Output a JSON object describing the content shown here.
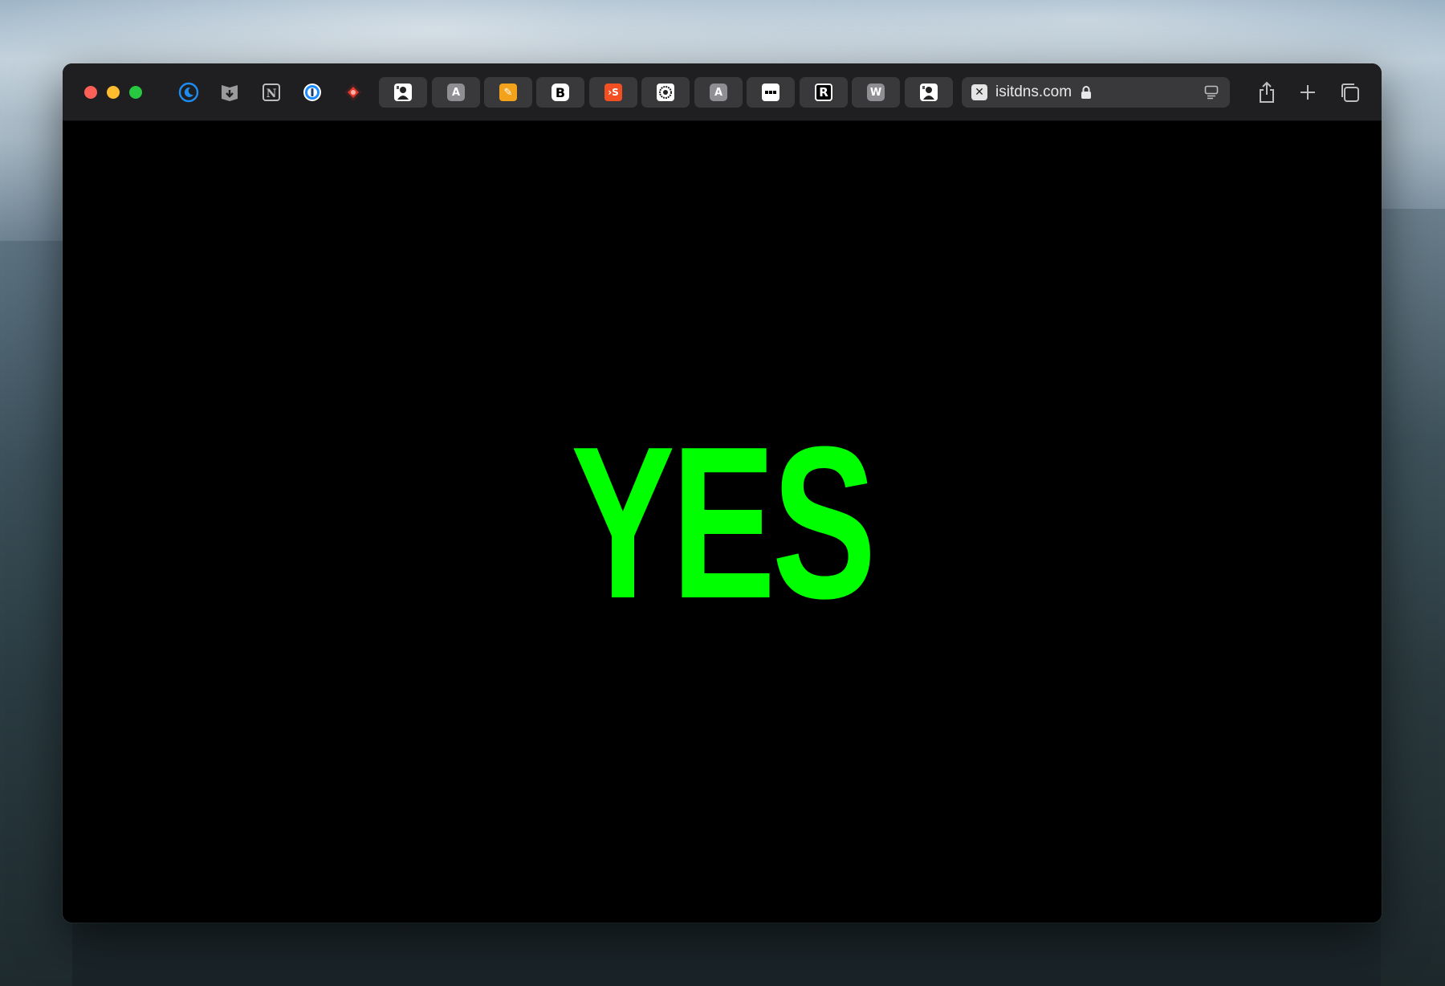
{
  "desktop": {
    "wallpaper": "mountain-landscape"
  },
  "browser": {
    "window_controls": [
      "close",
      "minimize",
      "zoom"
    ],
    "extensions": [
      {
        "name": "moon-icon",
        "color": "#1e8cf0"
      },
      {
        "name": "shield-download-icon",
        "color": "#9a9a9a"
      },
      {
        "name": "notion-icon",
        "glyph": "N"
      },
      {
        "name": "onepassword-icon",
        "color": "#1a8cff"
      },
      {
        "name": "red-diamond-icon",
        "color": "#e0382d"
      }
    ],
    "pinned_tabs": [
      {
        "icon": "portrait-icon",
        "glyph": ""
      },
      {
        "icon": "letter-a-icon",
        "glyph": "A"
      },
      {
        "icon": "pencil-icon",
        "glyph": "✎"
      },
      {
        "icon": "letter-b-icon",
        "glyph": "B"
      },
      {
        "icon": "letter-s-icon",
        "glyph": "›S"
      },
      {
        "icon": "badge-icon",
        "glyph": ""
      },
      {
        "icon": "letter-a-icon",
        "glyph": "A"
      },
      {
        "icon": "dots-icon",
        "glyph": "•••"
      },
      {
        "icon": "letter-r-icon",
        "glyph": "R"
      },
      {
        "icon": "letter-w-icon",
        "glyph": "W"
      },
      {
        "icon": "portrait-icon",
        "glyph": ""
      }
    ],
    "address_bar": {
      "favicon_glyph": "✕",
      "url": "isitdns.com",
      "secure": true
    },
    "toolbar_buttons": [
      "share",
      "new-tab",
      "tab-overview"
    ]
  },
  "page": {
    "answer": "YES",
    "answer_color": "#00ff00",
    "background": "#000000"
  }
}
